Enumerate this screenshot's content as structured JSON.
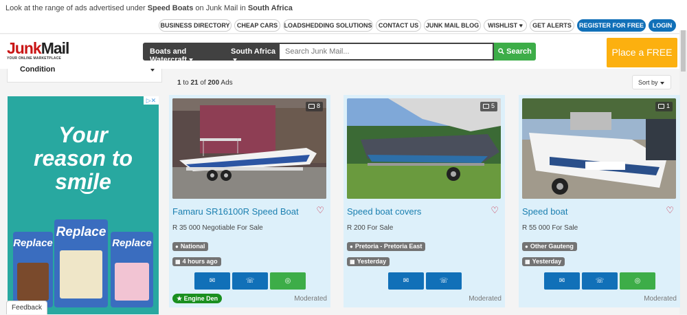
{
  "breadcrumb": {
    "prefix": "Look at the range of ads advertised under ",
    "category": "Speed Boats",
    "middle": " on Junk Mail in ",
    "region": "South Africa"
  },
  "topnav": {
    "links": [
      "BUSINESS DIRECTORY",
      "CHEAP CARS",
      "LOADSHEDDING SOLUTIONS",
      "CONTACT US",
      "JUNK MAIL BLOG",
      "WISHLIST ♥",
      "GET ALERTS"
    ],
    "register": "REGISTER FOR FREE",
    "login": "LOGIN"
  },
  "header": {
    "logo_junk": "Junk",
    "logo_mail": "Mail",
    "logo_tag": "YOUR ONLINE MARKETPLACE",
    "category_dropdown": "Boats and Watercraft",
    "location_dropdown": "South Africa",
    "search_placeholder": "Search Junk Mail...",
    "search_button": "Search",
    "place_ad": "Place a FREE Ad"
  },
  "sidebar": {
    "filter_label": "Condition",
    "ad": {
      "line1": "Your",
      "line2": "reason to",
      "line3": "smile",
      "can_label": "Replace"
    },
    "feedback": "Feedback"
  },
  "results": {
    "from": "1",
    "to": "21",
    "total": "200",
    "of_text": "of",
    "ads_text": "Ads",
    "to_text": "to",
    "sort_label": "Sort by"
  },
  "listings": [
    {
      "photos": "8",
      "title": "Famaru SR16100R Speed Boat",
      "price": "R 35 000 Negotiable For Sale",
      "location": "National",
      "posted": "4 hours ago",
      "dealer": "Engine Den",
      "status": "Moderated",
      "has_whatsapp": true
    },
    {
      "photos": "5",
      "title": "Speed boat covers",
      "price": "R 200 For Sale",
      "location": "Pretoria - Pretoria East",
      "posted": "Yesterday",
      "dealer": "",
      "status": "Moderated",
      "has_whatsapp": false
    },
    {
      "photos": "1",
      "title": "Speed boat",
      "price": "R 55 000 For Sale",
      "location": "Other Gauteng",
      "posted": "Yesterday",
      "dealer": "",
      "status": "Moderated",
      "has_whatsapp": true
    }
  ],
  "colors": {
    "brand_red": "#c91515",
    "accent_blue": "#1170b8",
    "whatsapp_green": "#3dad48",
    "place_ad_orange": "#fcb00f",
    "card_bg": "#ddf0fa"
  }
}
